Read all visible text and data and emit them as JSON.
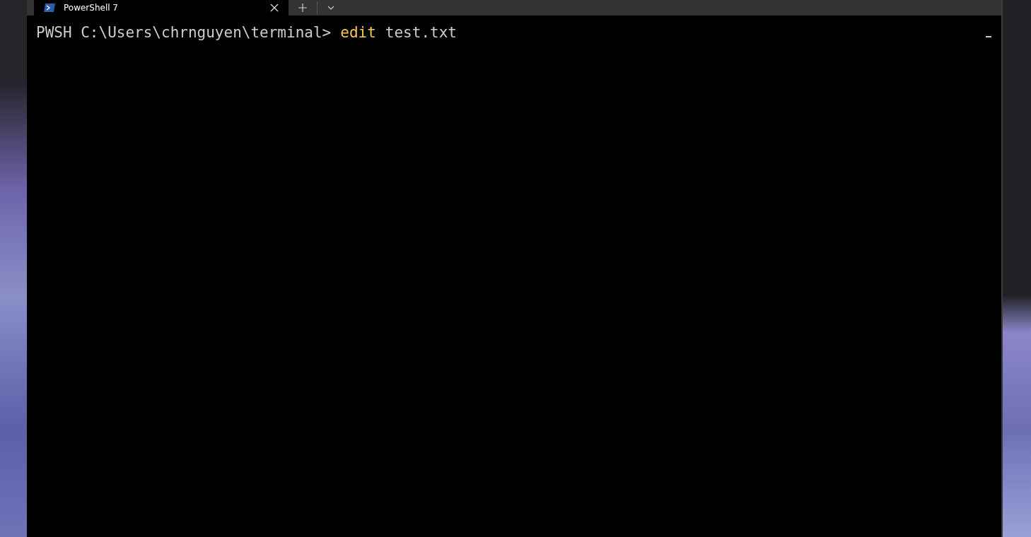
{
  "tabs": [
    {
      "title": "PowerShell 7",
      "selected": true
    }
  ],
  "terminal": {
    "prompt": "PWSH C:\\Users\\chrnguyen\\terminal>",
    "command": "edit",
    "arguments": "test.txt"
  }
}
